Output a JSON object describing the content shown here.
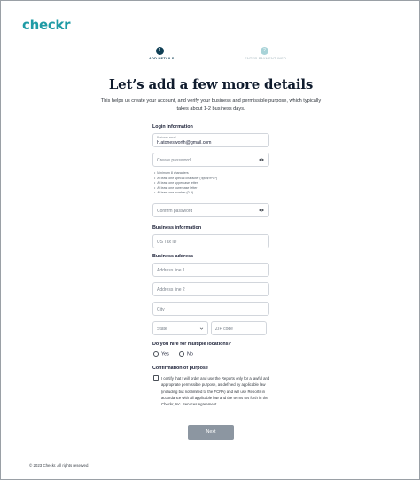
{
  "brand": {
    "logo_text": "checkr",
    "accent_color": "#1e9ba5"
  },
  "stepper": {
    "steps": [
      {
        "number": "1",
        "label": "ADD DETAILS",
        "state": "active"
      },
      {
        "number": "2",
        "label": "ENTER PAYMENT INFO",
        "state": "inactive"
      }
    ]
  },
  "header": {
    "title": "Let’s add a few more details",
    "subtitle": "This helps us create your account, and verify your business and permissible purpose, which typically takes about 1-2 business days."
  },
  "login": {
    "section_label": "Login information",
    "email": {
      "label": "Business email",
      "value": "h.atonesworth@gmail.com"
    },
    "password": {
      "placeholder": "Create password"
    },
    "rules": [
      "Minimum 8 characters",
      "At least one special character (!@#$%^&*)",
      "At least one uppercase letter",
      "At least one lowercase letter",
      "At least one number (0-9)"
    ],
    "confirm": {
      "placeholder": "Confirm password"
    }
  },
  "business": {
    "section_label": "Business information",
    "tax_id": {
      "placeholder": "US Tax ID"
    }
  },
  "address": {
    "section_label": "Business address",
    "line1": {
      "placeholder": "Address line 1"
    },
    "line2": {
      "placeholder": "Address line 2"
    },
    "city": {
      "placeholder": "City"
    },
    "state": {
      "placeholder": "State"
    },
    "zip": {
      "placeholder": "ZIP code"
    }
  },
  "locations": {
    "question": "Do you hire for multiple locations?",
    "options": [
      "Yes",
      "No"
    ]
  },
  "purpose": {
    "section_label": "Confirmation of purpose",
    "certify_text": "I certify that I will order and use the Reports only for a lawful and appropriate permissible purpose, as defined by applicable law (including but not limited to the FCRA) and will use Reports in accordance with all applicable law and the terms set forth in the Checkr, Inc. Services Agreement."
  },
  "actions": {
    "next_label": "Next"
  },
  "footer": {
    "copyright": "© 2023 Checkr. All rights reserved."
  }
}
